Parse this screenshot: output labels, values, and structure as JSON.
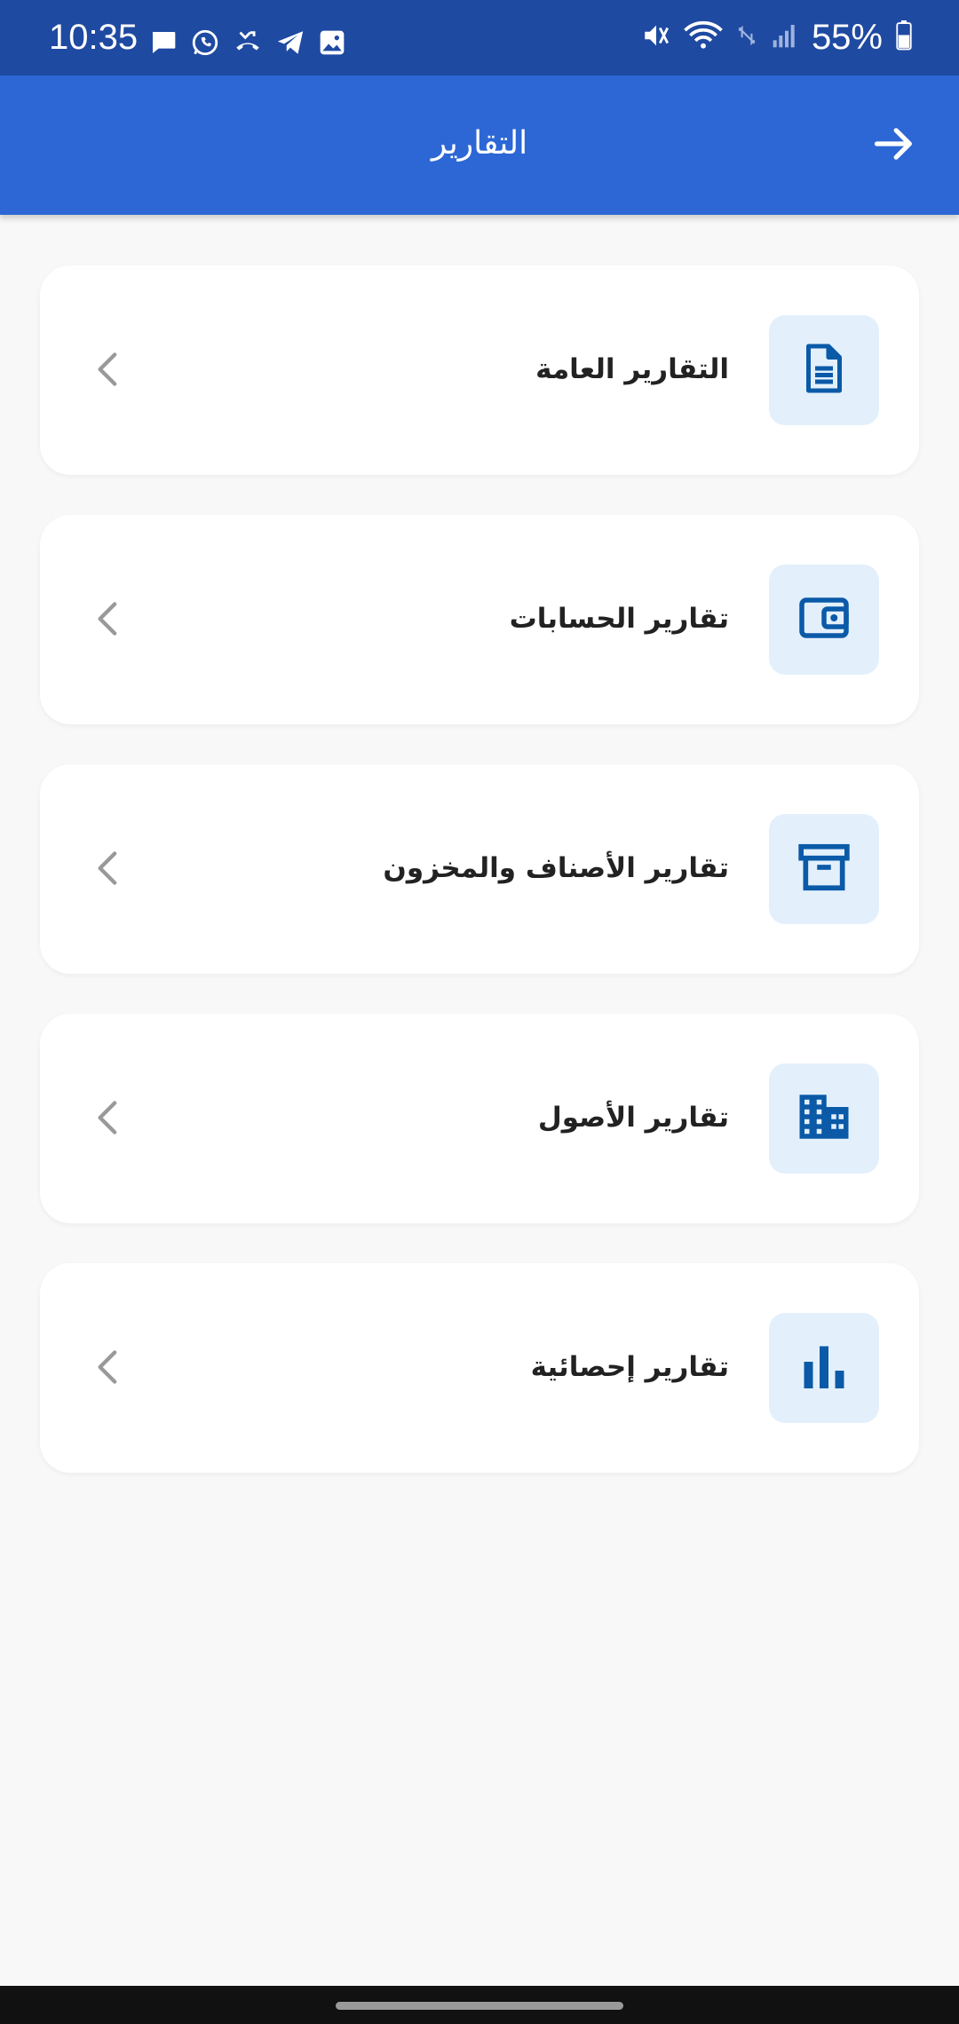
{
  "status_bar": {
    "time": "10:35",
    "battery_percent": "55%",
    "battery_level": 0.55,
    "left_icons": [
      "message-icon",
      "whatsapp-icon",
      "missed-call-icon",
      "telegram-icon",
      "gallery-icon"
    ],
    "right_icons": [
      "mute-icon",
      "wifi-icon",
      "data-off-icon",
      "signal-icon",
      "battery-icon"
    ],
    "background": "#1f4aa1"
  },
  "app_bar": {
    "title": "التقارير",
    "back_icon": "arrow-right-icon",
    "background": "#2c67d5"
  },
  "menu": {
    "items": [
      {
        "label": "التقارير العامة",
        "icon": "document-icon"
      },
      {
        "label": "تقارير الحسابات",
        "icon": "wallet-icon"
      },
      {
        "label": "تقارير الأصناف والمخزون",
        "icon": "archive-box-icon"
      },
      {
        "label": "تقارير الأصول",
        "icon": "building-icon"
      },
      {
        "label": "تقارير إحصائية",
        "icon": "bar-chart-icon"
      }
    ],
    "chevron_icon": "chevron-left-icon",
    "icon_color": "#0b5aa8",
    "icon_background": "#e3f0fc"
  }
}
